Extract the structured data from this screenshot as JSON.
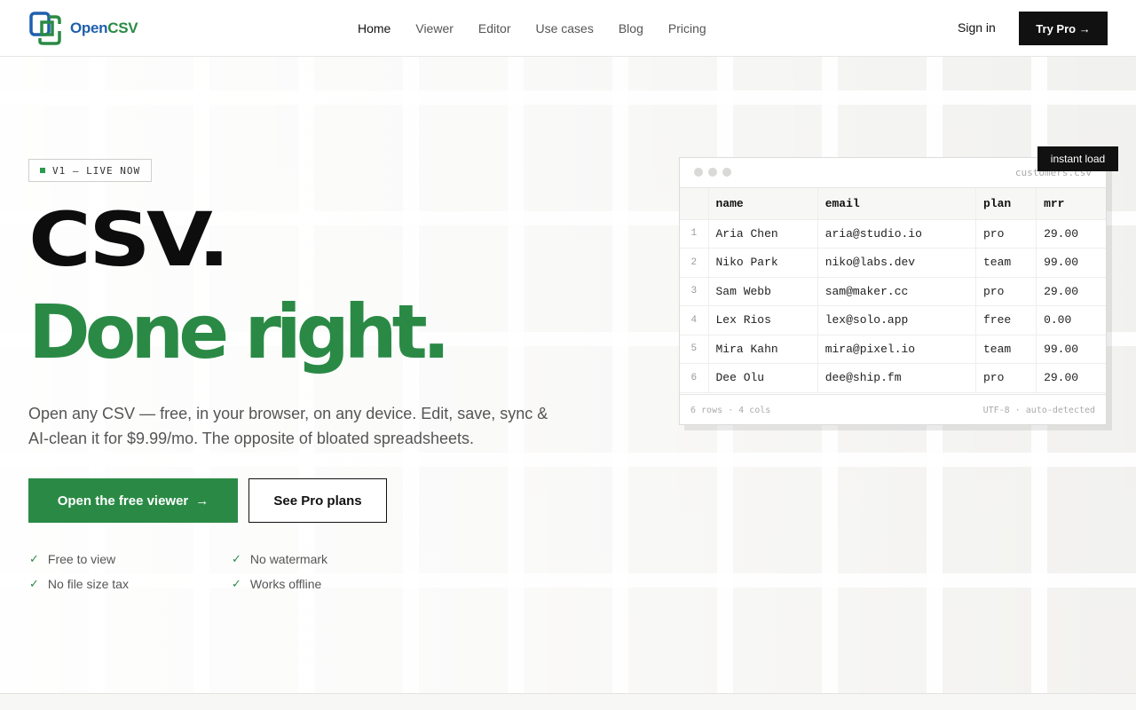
{
  "brand": {
    "open": "Open",
    "csv": "CSV",
    "blue": "#1f5fae",
    "green": "#2a8a45"
  },
  "nav": {
    "items": [
      {
        "label": "Home",
        "active": true
      },
      {
        "label": "Viewer"
      },
      {
        "label": "Editor"
      },
      {
        "label": "Use cases"
      },
      {
        "label": "Blog"
      },
      {
        "label": "Pricing"
      }
    ],
    "signin": "Sign in",
    "trypro": "Try Pro →"
  },
  "hero": {
    "badge": "V1 — LIVE NOW",
    "title_line1": "CSV.",
    "title_line2": "Done right.",
    "subtitle": "Open any CSV — free, in your browser, on any device. Edit, save, sync & AI-clean it for $9.99/mo. The opposite of bloated spreadsheets.",
    "primary_cta": "Open the free viewer",
    "primary_arrow": "→",
    "secondary_cta": "See Pro plans",
    "features": [
      "Free to view",
      "No watermark",
      "No file size tax",
      "Works offline"
    ]
  },
  "preview": {
    "tag": "instant load",
    "filename": "customers.csv",
    "columns": [
      "name",
      "email",
      "plan",
      "mrr"
    ],
    "rows": [
      [
        "1",
        "Aria Chen",
        "aria@studio.io",
        "pro",
        "29.00"
      ],
      [
        "2",
        "Niko Park",
        "niko@labs.dev",
        "team",
        "99.00"
      ],
      [
        "3",
        "Sam Webb",
        "sam@maker.cc",
        "pro",
        "29.00"
      ],
      [
        "4",
        "Lex Rios",
        "lex@solo.app",
        "free",
        "0.00"
      ],
      [
        "5",
        "Mira Kahn",
        "mira@pixel.io",
        "team",
        "99.00"
      ],
      [
        "6",
        "Dee Olu",
        "dee@ship.fm",
        "pro",
        "29.00"
      ]
    ],
    "footer_left": "6 rows · 4 cols",
    "footer_right": "UTF-8 · auto-detected"
  }
}
